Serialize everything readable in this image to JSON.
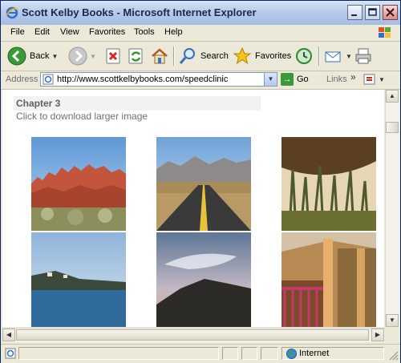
{
  "window": {
    "title": "Scott Kelby Books - Microsoft Internet Explorer"
  },
  "menu": [
    "File",
    "Edit",
    "View",
    "Favorites",
    "Tools",
    "Help"
  ],
  "toolbar": {
    "back_label": "Back",
    "search_label": "Search",
    "favorites_label": "Favorites"
  },
  "address": {
    "label": "Address",
    "url": "http://www.scottkelbybooks.com/speedclinic",
    "go_label": "Go",
    "links_label": "Links",
    "links_chevron": "»"
  },
  "page": {
    "heading": "Chapter 3",
    "subheading": "Click to download larger image",
    "photos": [
      "red-rock-desert",
      "desert-highway",
      "sunset-grass",
      "coastal-village",
      "dusk-mountains",
      "porch-railing"
    ]
  },
  "status": {
    "zone": "Internet"
  },
  "colors": {
    "titlebar": "#b7cbe9",
    "chrome": "#ece9d8",
    "page_heading": "#606060"
  }
}
